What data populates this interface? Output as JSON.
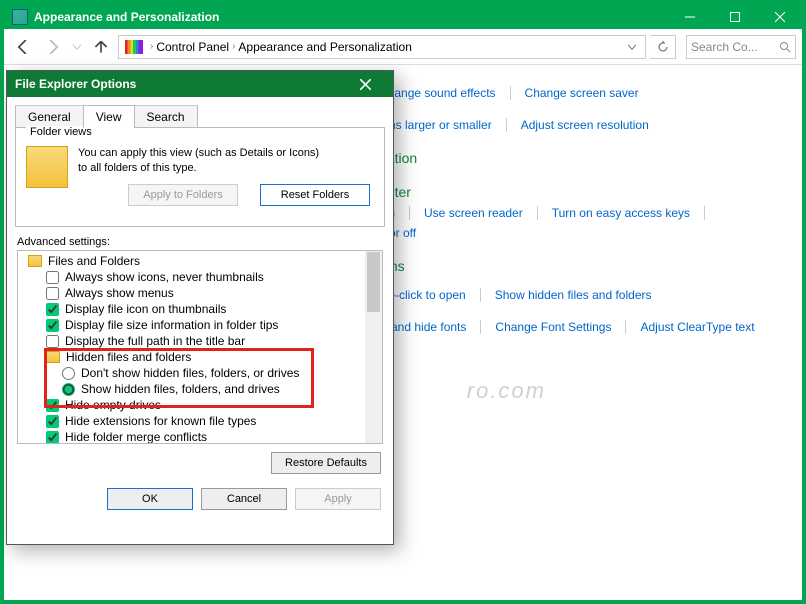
{
  "titlebar": {
    "title": "Appearance and Personalization"
  },
  "breadcrumb": {
    "levels": [
      "Control Panel",
      "Appearance and Personalization"
    ]
  },
  "search": {
    "placeholder": "Search Co..."
  },
  "categories": [
    {
      "heading": "",
      "links": [
        "Change sound effects",
        "Change screen saver"
      ]
    },
    {
      "heading": "",
      "links": [
        "ems larger or smaller",
        "Adjust screen resolution"
      ]
    },
    {
      "heading": "gation",
      "links": []
    },
    {
      "heading": "enter",
      "links": [
        "ion",
        "Use screen reader",
        "Turn on easy access keys",
        "n or off"
      ]
    },
    {
      "heading": "ions",
      "links": [
        "ble-click to open",
        "Show hidden files and folders"
      ]
    },
    {
      "heading": "",
      "links": [
        "w and hide fonts",
        "Change Font Settings",
        "Adjust ClearType text"
      ]
    }
  ],
  "dialog": {
    "title": "File Explorer Options",
    "tabs": [
      "General",
      "View",
      "Search"
    ],
    "active_tab": 1,
    "folder_views": {
      "legend": "Folder views",
      "text": "You can apply this view (such as Details or Icons) to all folders of this type.",
      "apply": "Apply to Folders",
      "reset": "Reset Folders"
    },
    "advanced_label": "Advanced settings:",
    "tree": {
      "root": "Files and Folders",
      "items": [
        {
          "type": "check",
          "checked": false,
          "label": "Always show icons, never thumbnails"
        },
        {
          "type": "check",
          "checked": false,
          "label": "Always show menus"
        },
        {
          "type": "check",
          "checked": true,
          "label": "Display file icon on thumbnails"
        },
        {
          "type": "check",
          "checked": true,
          "label": "Display file size information in folder tips"
        },
        {
          "type": "check",
          "checked": false,
          "label": "Display the full path in the title bar"
        },
        {
          "type": "group",
          "label": "Hidden files and folders",
          "children": [
            {
              "type": "radio",
              "checked": false,
              "label": "Don't show hidden files, folders, or drives"
            },
            {
              "type": "radio",
              "checked": true,
              "label": "Show hidden files, folders, and drives"
            }
          ]
        },
        {
          "type": "check",
          "checked": true,
          "label": "Hide empty drives"
        },
        {
          "type": "check",
          "checked": true,
          "label": "Hide extensions for known file types"
        },
        {
          "type": "check",
          "checked": true,
          "label": "Hide folder merge conflicts"
        }
      ]
    },
    "restore": "Restore Defaults",
    "ok": "OK",
    "cancel": "Cancel",
    "apply": "Apply"
  },
  "watermark": "ro.com"
}
